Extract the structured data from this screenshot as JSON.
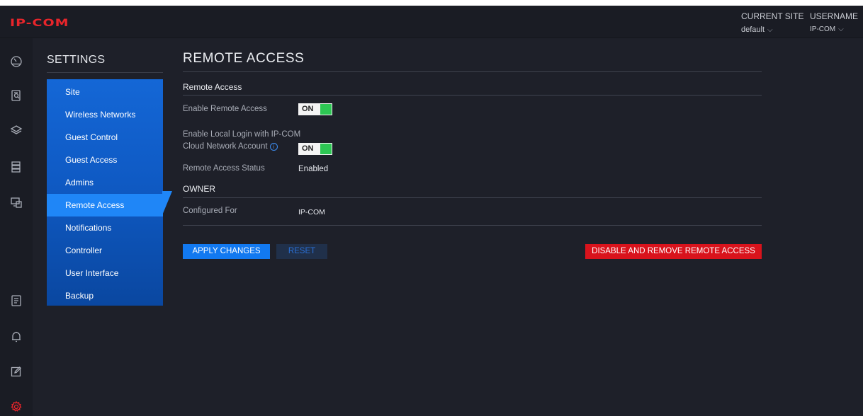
{
  "app": {
    "logo_text": "IP-COM"
  },
  "header": {
    "current_site_label": "CURRENT SITE",
    "current_site_value": "default",
    "username_label": "USERNAME",
    "username_value": "IP-COM",
    "chevron": "⌵"
  },
  "rail_icons": [
    "dashboard-icon",
    "statistics-icon",
    "layers-icon",
    "devices-icon",
    "clients-icon",
    "log-icon",
    "alerts-icon",
    "edit-icon",
    "settings-icon"
  ],
  "settings": {
    "title": "SETTINGS",
    "menu": [
      {
        "label": "Site"
      },
      {
        "label": "Wireless Networks"
      },
      {
        "label": "Guest Control"
      },
      {
        "label": "Guest Access"
      },
      {
        "label": "Admins"
      },
      {
        "label": "Remote Access",
        "active": true
      },
      {
        "label": "Notifications"
      },
      {
        "label": "Controller"
      },
      {
        "label": "User Interface"
      },
      {
        "label": "Backup"
      }
    ]
  },
  "main": {
    "title": "REMOTE ACCESS",
    "section_remote": "Remote Access",
    "enable_remote_label": "Enable Remote Access",
    "enable_remote_toggle": "ON",
    "local_login_label_1": "Enable Local Login with IP-COM",
    "local_login_label_2": "Cloud Network Account",
    "local_login_info": "i",
    "local_login_toggle": "ON",
    "status_label": "Remote Access Status",
    "status_value": "Enabled",
    "section_owner": "OWNER",
    "configured_for_label": "Configured For",
    "configured_for_value": "IP-COM",
    "apply_button": "APPLY CHANGES",
    "reset_button": "RESET",
    "disable_button": "DISABLE AND REMOVE REMOTE ACCESS"
  },
  "colors": {
    "accent": "#1279f0",
    "danger": "#d9131c",
    "toggle_on": "#2dc653",
    "logo": "#e8252b",
    "background": "#1e2029"
  }
}
